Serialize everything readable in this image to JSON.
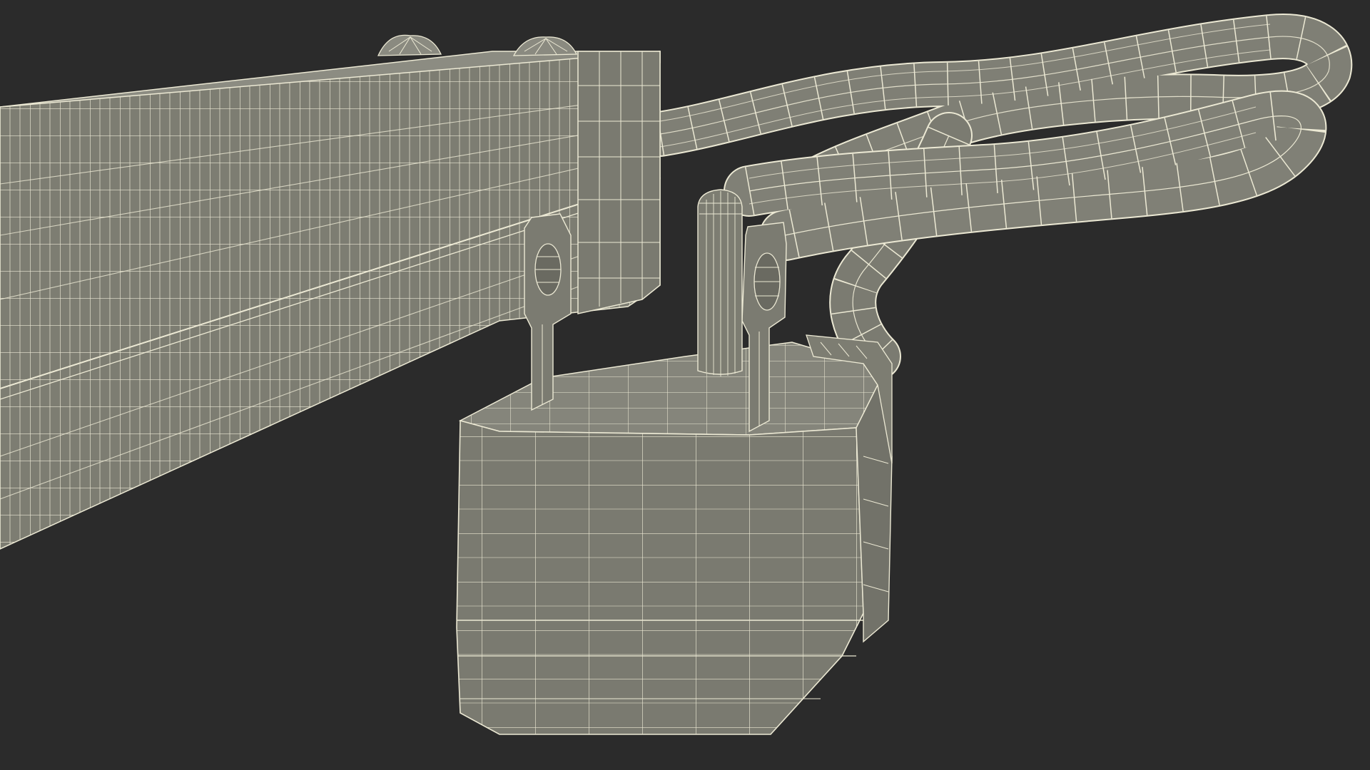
{
  "viewport": {
    "background_color": "#2b2b2b",
    "surface_color": "#7d7d72",
    "surface_dark_color": "#6c6c63",
    "surface_light_color": "#8a8a80",
    "wire_color": "#ece9d4"
  },
  "scene": {
    "objects": [
      {
        "name": "power-strip-body"
      },
      {
        "name": "power-strip-mount-bump"
      },
      {
        "name": "power-cord"
      },
      {
        "name": "plug-body"
      },
      {
        "name": "plug-prong"
      },
      {
        "name": "ground-pin"
      }
    ]
  }
}
